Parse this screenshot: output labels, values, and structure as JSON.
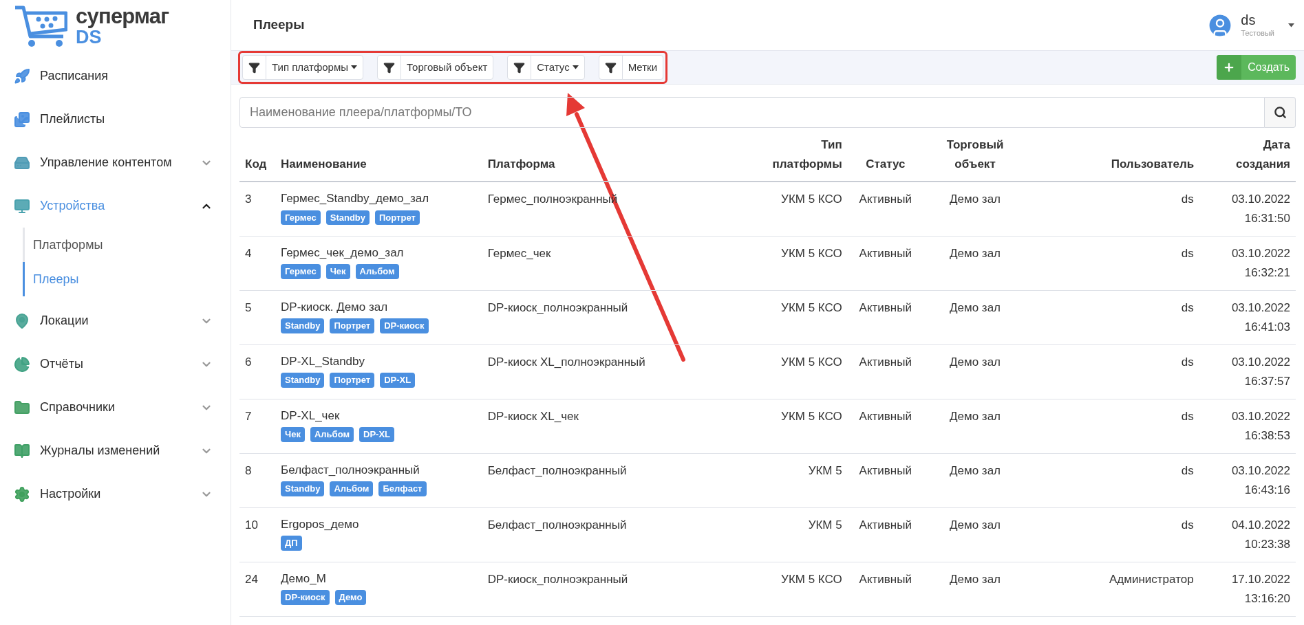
{
  "logo": {
    "title": "супермаг",
    "subtitle": "DS"
  },
  "sidebar": {
    "items": [
      {
        "label": "Расписания",
        "kind": "link",
        "selected": false
      },
      {
        "label": "Плейлисты",
        "kind": "link",
        "selected": false
      },
      {
        "label": "Управление контентом",
        "kind": "group",
        "selected": false,
        "expanded": false
      },
      {
        "label": "Устройства",
        "kind": "group",
        "selected": true,
        "expanded": true,
        "children": [
          {
            "label": "Платформы",
            "selected": false
          },
          {
            "label": "Плееры",
            "selected": true
          }
        ]
      },
      {
        "label": "Локации",
        "kind": "group",
        "selected": false,
        "expanded": false
      },
      {
        "label": "Отчёты",
        "kind": "group",
        "selected": false,
        "expanded": false
      },
      {
        "label": "Справочники",
        "kind": "group",
        "selected": false,
        "expanded": false
      },
      {
        "label": "Журналы изменений",
        "kind": "group",
        "selected": false,
        "expanded": false
      },
      {
        "label": "Настройки",
        "kind": "group",
        "selected": false,
        "expanded": false
      }
    ]
  },
  "header": {
    "title": "Плееры",
    "user": {
      "name": "ds",
      "role": "Тестовый"
    }
  },
  "filters": [
    {
      "label": "Тип платформы",
      "dropdown": true
    },
    {
      "label": "Торговый объект",
      "dropdown": false
    },
    {
      "label": "Статус",
      "dropdown": true
    },
    {
      "label": "Метки",
      "dropdown": false
    }
  ],
  "create_button": "Создать",
  "search": {
    "placeholder": "Наименование плеера/платформы/ТО"
  },
  "table": {
    "columns": [
      "Код",
      "Наименование",
      "Платформа",
      "Тип платформы",
      "Статус",
      "Торговый объект",
      "Пользователь",
      "Дата создания"
    ],
    "rows": [
      {
        "code": "3",
        "name": "Гермес_Standby_демо_зал",
        "tags": [
          "Гермес",
          "Standby",
          "Портрет"
        ],
        "platform": "Гермес_полноэкранный",
        "platform_type": "УКМ 5 КСО",
        "status": "Активный",
        "store": "Демо зал",
        "user": "ds",
        "created": "03.10.2022 16:31:50"
      },
      {
        "code": "4",
        "name": "Гермес_чек_демо_зал",
        "tags": [
          "Гермес",
          "Чек",
          "Альбом"
        ],
        "platform": "Гермес_чек",
        "platform_type": "УКМ 5 КСО",
        "status": "Активный",
        "store": "Демо зал",
        "user": "ds",
        "created": "03.10.2022 16:32:21"
      },
      {
        "code": "5",
        "name": "DP-киоск. Демо зал",
        "tags": [
          "Standby",
          "Портрет",
          "DP-киоск"
        ],
        "platform": "DP-киоск_полноэкранный",
        "platform_type": "УКМ 5 КСО",
        "status": "Активный",
        "store": "Демо зал",
        "user": "ds",
        "created": "03.10.2022 16:41:03"
      },
      {
        "code": "6",
        "name": "DP-XL_Standby",
        "tags": [
          "Standby",
          "Портрет",
          "DP-XL"
        ],
        "platform": "DP-киоск XL_полноэкранный",
        "platform_type": "УКМ 5 КСО",
        "status": "Активный",
        "store": "Демо зал",
        "user": "ds",
        "created": "03.10.2022 16:37:57"
      },
      {
        "code": "7",
        "name": "DP-XL_чек",
        "tags": [
          "Чек",
          "Альбом",
          "DP-XL"
        ],
        "platform": "DP-киоск XL_чек",
        "platform_type": "УКМ 5 КСО",
        "status": "Активный",
        "store": "Демо зал",
        "user": "ds",
        "created": "03.10.2022 16:38:53"
      },
      {
        "code": "8",
        "name": "Белфаст_полноэкранный",
        "tags": [
          "Standby",
          "Альбом",
          "Белфаст"
        ],
        "platform": "Белфаст_полноэкранный",
        "platform_type": "УКМ 5",
        "status": "Активный",
        "store": "Демо зал",
        "user": "ds",
        "created": "03.10.2022 16:43:16"
      },
      {
        "code": "10",
        "name": "Ergopos_демо",
        "tags": [
          "ДП"
        ],
        "platform": "Белфаст_полноэкранный",
        "platform_type": "УКМ 5",
        "status": "Активный",
        "store": "Демо зал",
        "user": "ds",
        "created": "04.10.2022 10:23:38"
      },
      {
        "code": "24",
        "name": "Демо_М",
        "tags": [
          "DP-киоск",
          "Демо"
        ],
        "platform": "DP-киоск_полноэкранный",
        "platform_type": "УКМ 5 КСО",
        "status": "Активный",
        "store": "Демо зал",
        "user": "Администратор",
        "created": "17.10.2022 13:16:20"
      }
    ]
  }
}
